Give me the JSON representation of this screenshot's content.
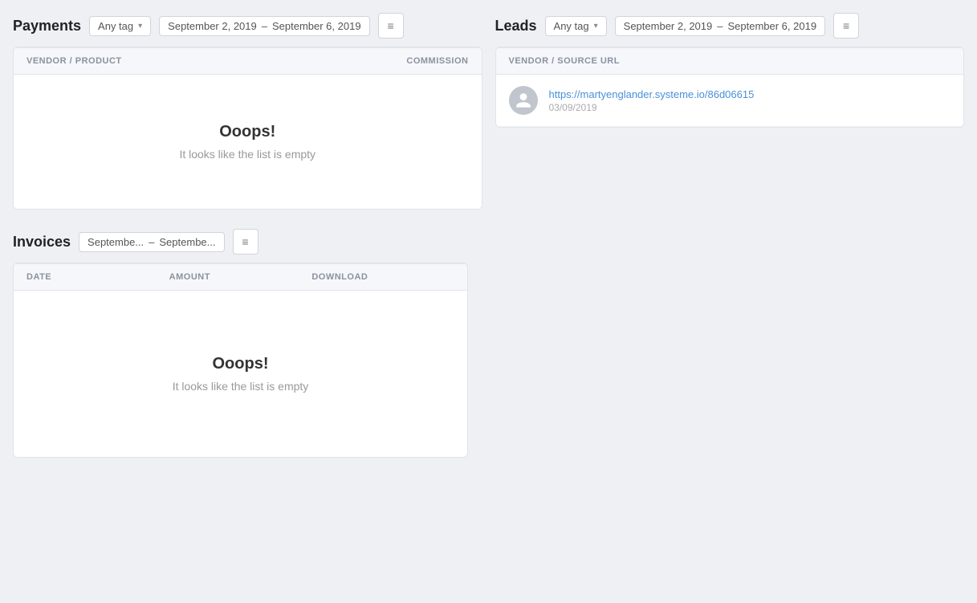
{
  "payments": {
    "title": "Payments",
    "tag_selector": {
      "label": "Any tag",
      "placeholder": "Any tag"
    },
    "date_range": {
      "start": "September 2, 2019",
      "end": "September 6, 2019",
      "separator": "–"
    },
    "table": {
      "col_vendor": "VENDOR / PRODUCT",
      "col_commission": "COMMISSION"
    },
    "empty": {
      "title": "Ooops!",
      "subtitle": "It looks like the list is empty"
    }
  },
  "leads": {
    "title": "Leads",
    "tag_selector": {
      "label": "Any tag"
    },
    "date_range": {
      "start": "September 2, 2019",
      "end": "September 6, 2019",
      "separator": "–"
    },
    "table": {
      "col_vendor_source": "VENDOR / SOURCE URL"
    },
    "items": [
      {
        "url": "https://martyenglander.systeme.io/86d06615",
        "date": "03/09/2019"
      }
    ]
  },
  "invoices": {
    "title": "Invoices",
    "date_range": {
      "start": "Septembe...",
      "end": "Septembe...",
      "separator": "–"
    },
    "table": {
      "col_date": "DATE",
      "col_amount": "AMOUNT",
      "col_download": "DOWNLOAD"
    },
    "empty": {
      "title": "Ooops!",
      "subtitle": "It looks like the list is empty"
    }
  }
}
